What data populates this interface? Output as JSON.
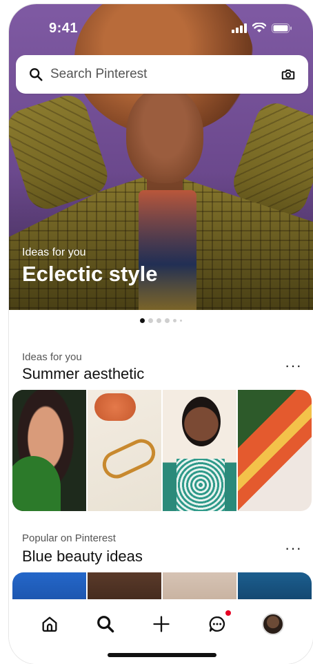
{
  "status_bar": {
    "time": "9:41"
  },
  "search": {
    "placeholder": "Search Pinterest"
  },
  "hero": {
    "subtitle": "Ideas for you",
    "title": "Eclectic style"
  },
  "carousel": {
    "total": 6,
    "active_index": 0
  },
  "sections": [
    {
      "subtitle": "Ideas for you",
      "title": "Summer aesthetic",
      "more": "···"
    },
    {
      "subtitle": "Popular on Pinterest",
      "title": "Blue beauty ideas",
      "more": "···"
    }
  ],
  "tabs": [
    "home",
    "search",
    "create",
    "messages",
    "profile"
  ],
  "colors": {
    "accent": "#e60023",
    "hero_purple": "#7f5aa3"
  }
}
